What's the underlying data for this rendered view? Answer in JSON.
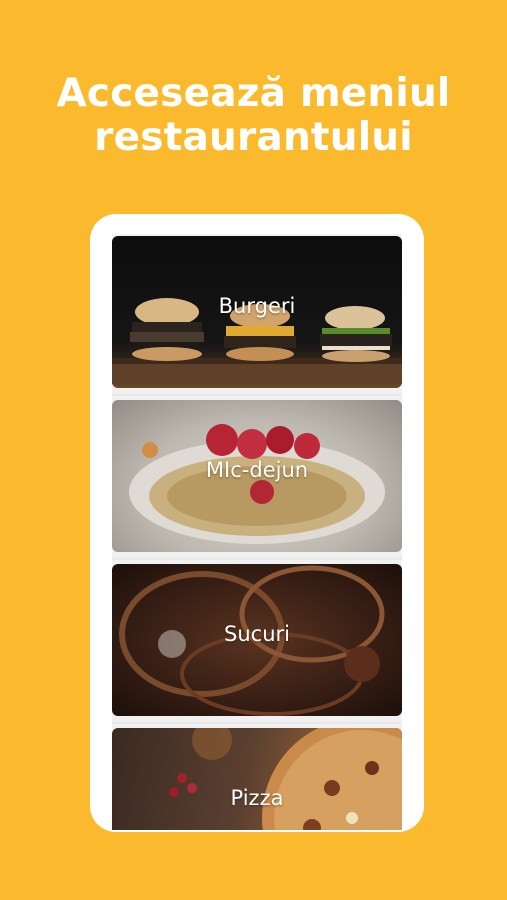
{
  "header": {
    "line1": "Accesează meniul",
    "line2": "restaurantului"
  },
  "menu": {
    "categories": [
      {
        "label": "Burgeri"
      },
      {
        "label": "MIc-dejun"
      },
      {
        "label": "Sucuri"
      },
      {
        "label": "Pizza"
      }
    ]
  }
}
